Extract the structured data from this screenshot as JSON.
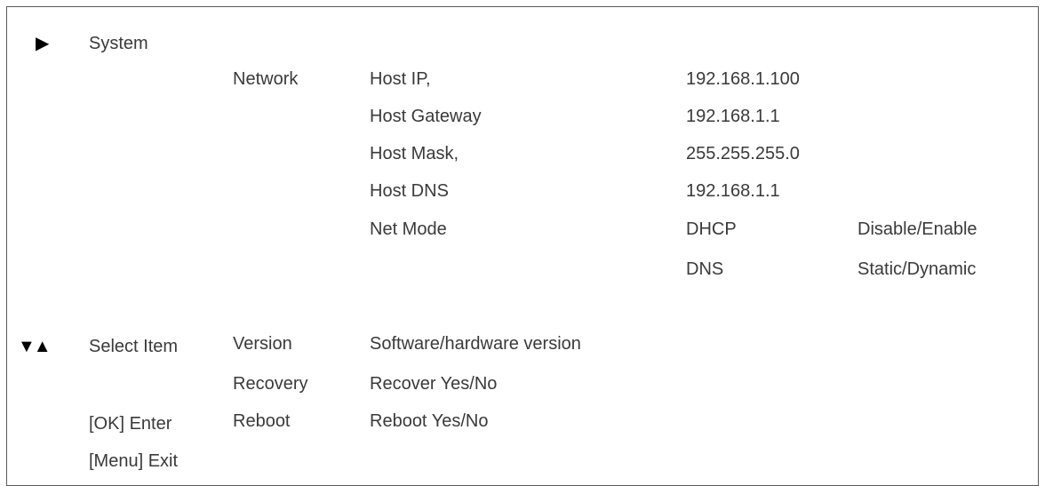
{
  "menu": {
    "system_icon": "play-arrow-icon",
    "system_label": "System",
    "network_label": "Network",
    "settings": [
      {
        "name": "Host IP,",
        "value": "192.168.1.100"
      },
      {
        "name": "Host Gateway",
        "value": "192.168.1.1"
      },
      {
        "name": "Host Mask,",
        "value": "255.255.255.0"
      },
      {
        "name": "Host DNS",
        "value": "192.168.1.1"
      }
    ],
    "net_mode": {
      "name": "Net Mode",
      "options": [
        {
          "name": "DHCP",
          "value": "Disable/Enable"
        },
        {
          "name": "DNS",
          "value": "Static/Dynamic"
        }
      ]
    },
    "others": [
      {
        "name": "Version",
        "value": "Software/hardware version"
      },
      {
        "name": "Recovery",
        "value": "Recover Yes/No"
      },
      {
        "name": "Reboot",
        "value": "Reboot Yes/No"
      }
    ]
  },
  "controls": {
    "select_icon": "down-up-arrows-icon",
    "select_label": "Select Item",
    "enter_label": "[OK] Enter",
    "exit_label": "[Menu] Exit"
  }
}
